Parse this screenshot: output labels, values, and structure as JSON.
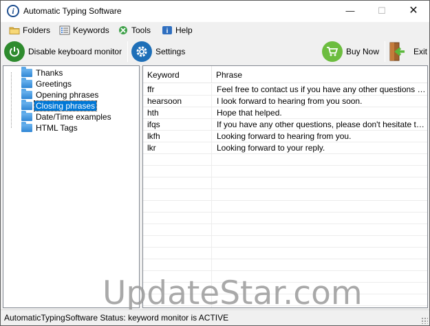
{
  "window": {
    "title": "Automatic Typing Software",
    "controls": {
      "minimize": "—",
      "maximize": "☐",
      "close": "✕"
    }
  },
  "menu": {
    "items": [
      {
        "label": "Folders",
        "icon": "folder-icon"
      },
      {
        "label": "Keywords",
        "icon": "keywords-icon"
      },
      {
        "label": "Tools",
        "icon": "tools-icon"
      },
      {
        "label": "Help",
        "icon": "help-icon"
      }
    ]
  },
  "toolbar": {
    "disable_label": "Disable keyboard monitor",
    "settings_label": "Settings",
    "buy_label": "Buy Now",
    "exit_label": "Exit",
    "colors": {
      "power": "#2e8b2e",
      "settings": "#1e6fb8",
      "buy": "#6cbd3f",
      "exit_arrow": "#5ab83a"
    }
  },
  "tree": {
    "items": [
      {
        "label": "Thanks",
        "selected": false
      },
      {
        "label": "Greetings",
        "selected": false
      },
      {
        "label": "Opening phrases",
        "selected": false
      },
      {
        "label": "Closing phrases",
        "selected": true
      },
      {
        "label": "Date/Time examples",
        "selected": false
      },
      {
        "label": "HTML Tags",
        "selected": false
      }
    ]
  },
  "grid": {
    "columns": {
      "keyword": "Keyword",
      "phrase": "Phrase"
    },
    "rows": [
      {
        "keyword": "ffr",
        "phrase": "Feel free to contact us if you have any other questions or com..."
      },
      {
        "keyword": "hearsoon",
        "phrase": "I look forward to hearing from you soon."
      },
      {
        "keyword": "hth",
        "phrase": "Hope that helped."
      },
      {
        "keyword": "ifqs",
        "phrase": "If you have any other questions, please don't hesitate to conta..."
      },
      {
        "keyword": "lkfh",
        "phrase": "Looking forward to hearing from you."
      },
      {
        "keyword": "lkr",
        "phrase": "Looking forward to your reply."
      }
    ],
    "empty_row_count": 14
  },
  "watermark": "UpdateStar.com",
  "status": {
    "text": "AutomaticTypingSoftware Status: keyword monitor is ACTIVE"
  }
}
